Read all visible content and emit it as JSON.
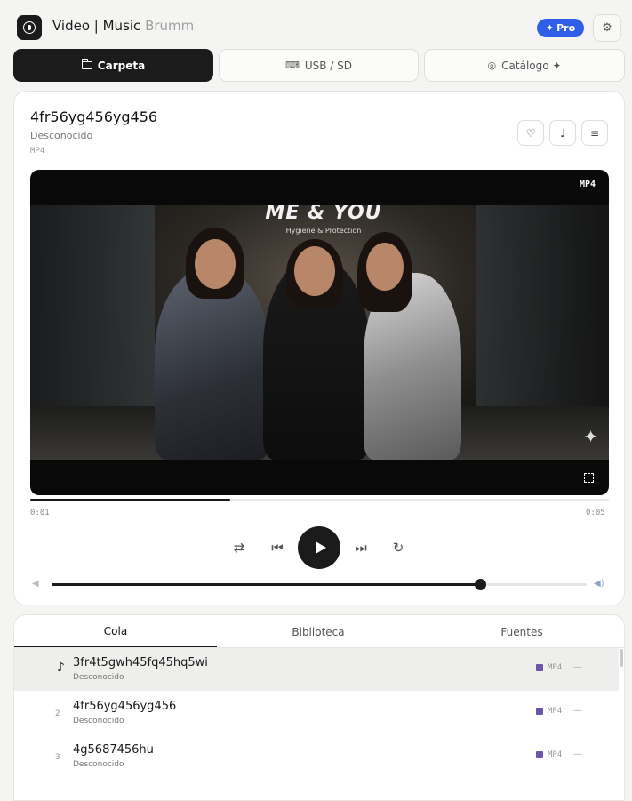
{
  "app": {
    "title": "Video | Music",
    "subtitle": "Brumm",
    "pro_label": "Pro"
  },
  "source_tabs": [
    {
      "label": "Carpeta",
      "icon": "folder-icon",
      "active": true
    },
    {
      "label": "USB / SD",
      "icon": "usb-icon",
      "active": false
    },
    {
      "label": "Catálogo ✦",
      "icon": "check-circle-icon",
      "active": false
    }
  ],
  "now_playing": {
    "title": "4fr56yg456yg456",
    "artist": "Desconocido",
    "format": "MP4",
    "badge": "MP4",
    "sign_text": "ME & YOU",
    "sign_sub": "Hygiene & Protection",
    "time_current": "0:01",
    "time_total": "0:05",
    "progress": 0.345,
    "volume": 0.8
  },
  "queue": {
    "tabs": [
      "Cola",
      "Biblioteca",
      "Fuentes"
    ],
    "items": [
      {
        "num": "",
        "title": "3fr4t5gwh45fq45hq5wi",
        "artist": "Desconocido",
        "format": "MP4",
        "dash": "—",
        "current": true
      },
      {
        "num": "2",
        "title": "4fr56yg456yg456",
        "artist": "Desconocido",
        "format": "MP4",
        "dash": "—",
        "current": false
      },
      {
        "num": "3",
        "title": "4g5687456hu",
        "artist": "Desconocido",
        "format": "MP4",
        "dash": "—",
        "current": false
      }
    ]
  }
}
